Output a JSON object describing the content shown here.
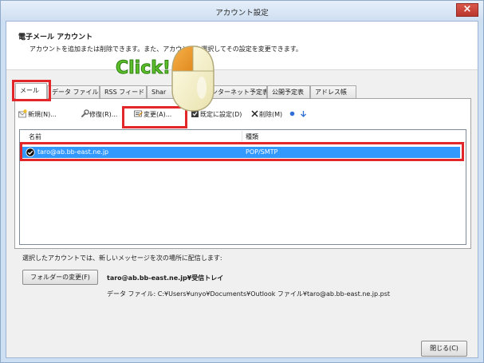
{
  "window": {
    "title": "アカウント設定",
    "close_label": "×"
  },
  "header": {
    "title": "電子メール アカウント",
    "subtitle": "アカウントを追加または削除できます。また、アカウントを選択してその設定を変更できます。"
  },
  "overlay": {
    "click_label": "Click!"
  },
  "tabs": [
    {
      "label": "メール",
      "selected": true
    },
    {
      "label": "データ ファイル"
    },
    {
      "label": "RSS フィード"
    },
    {
      "label": "Shar"
    },
    {
      "label": "ンターネット予定表"
    },
    {
      "label": "公開予定表"
    },
    {
      "label": "アドレス帳"
    }
  ],
  "toolbar": {
    "new_label": "新規(N)...",
    "repair_label": "修復(R)...",
    "change_label": "変更(A)...",
    "set_default_label": "既定に設定(D)",
    "delete_label": "削除(M)"
  },
  "list": {
    "columns": [
      "名前",
      "種類"
    ],
    "rows": [
      {
        "name": "taro@ab.bb-east.ne.jp",
        "type": "POP/SMTP",
        "selected": true
      }
    ]
  },
  "delivery": {
    "label": "選択したアカウントでは、新しいメッセージを次の場所に配信します:",
    "change_folder_button": "フォルダーの変更(F)",
    "folder": "taro@ab.bb-east.ne.jp¥受信トレイ",
    "data_file": "データ ファイル: C:¥Users¥unyo¥Documents¥Outlook ファイル¥taro@ab.bb-east.ne.jp.pst"
  },
  "footer": {
    "close_button": "閉じる(C)"
  },
  "icons": {
    "new": "new-mail-icon",
    "repair": "wrench-icon",
    "change": "edit-card-icon",
    "set_default": "default-check-icon",
    "delete": "delete-x-icon",
    "move_up": "arrow-up-icon",
    "move_down": "arrow-down-icon",
    "account": "check-circle-icon",
    "cursor": "mouse-click-icon"
  },
  "colors": {
    "highlight_box": "#e3262a",
    "selected_row": "#3399ff",
    "close_button": "#c7453a",
    "click_text": "#5cbf2a"
  }
}
